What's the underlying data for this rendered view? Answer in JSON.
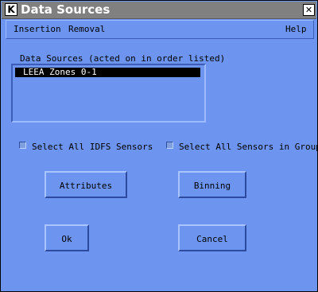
{
  "window": {
    "title": "Data Sources",
    "title_icon": "K",
    "close_glyph": "✕"
  },
  "menubar": {
    "insertion": "Insertion",
    "removal": "Removal",
    "help": "Help"
  },
  "sources": {
    "label": "Data Sources (acted on in order listed)",
    "items": [
      "LEEA Zones 0-1"
    ],
    "selected_index": 0
  },
  "options": {
    "select_all_idfs": {
      "label": "Select All IDFS Sensors",
      "checked": false
    },
    "select_all_group": {
      "label": "Select All Sensors in Group",
      "checked": false
    }
  },
  "buttons": {
    "attributes": "Attributes",
    "binning": "Binning",
    "ok": "Ok",
    "cancel": "Cancel"
  },
  "colors": {
    "background": "#6d95f0",
    "titlebar": "#808080",
    "selection": "#000000"
  }
}
